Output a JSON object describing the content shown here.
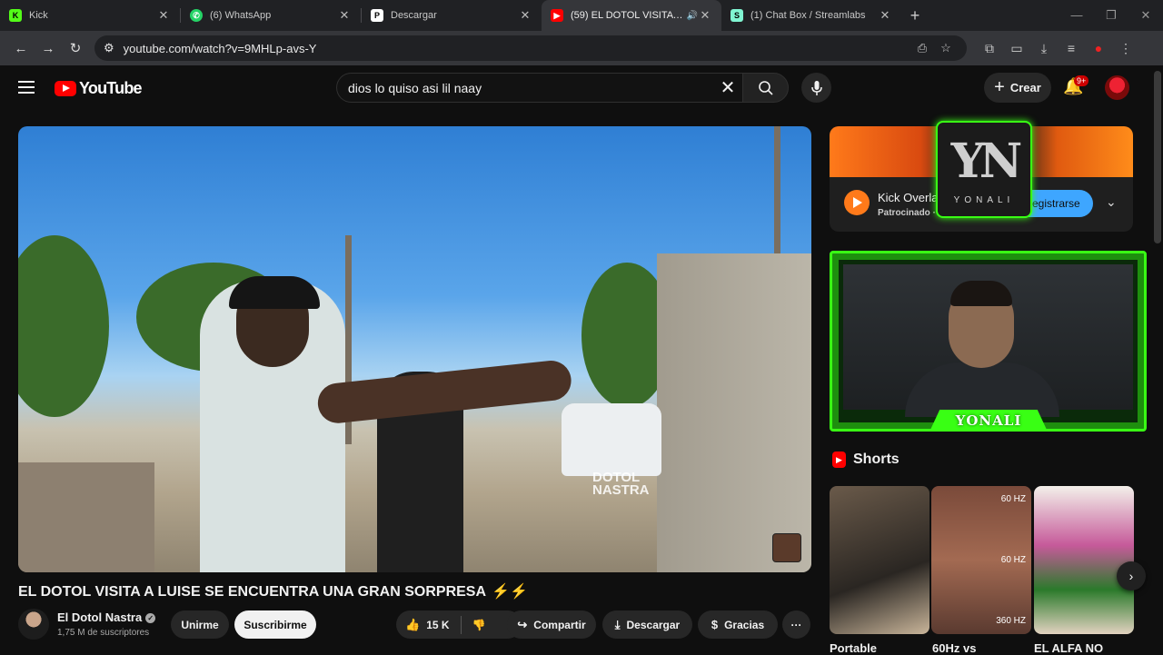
{
  "browser": {
    "tabs": [
      {
        "label": "Kick",
        "favicon": "kick-icon",
        "color": "#53fc18"
      },
      {
        "label": "(6) WhatsApp",
        "favicon": "whatsapp-icon",
        "color": "#25d366"
      },
      {
        "label": "Descargar",
        "favicon": "document-icon",
        "color": "#ffffff"
      },
      {
        "label": "(59) EL DOTOL VISITA A LUIS",
        "favicon": "youtube-icon",
        "color": "#ff0000",
        "active": true,
        "audio": true
      },
      {
        "label": "(1) Chat Box / Streamlabs",
        "favicon": "streamlabs-icon",
        "color": "#80f5d2"
      }
    ],
    "url": "youtube.com/watch?v=9MHLp-avs-Y"
  },
  "youtube": {
    "logo_text": "YouTube",
    "search_value": "dios lo quiso asi lil naay",
    "create_label": "Crear",
    "notif_count": "9+"
  },
  "video": {
    "watermark_line1": "DOTOL",
    "watermark_line2": "NASTRA",
    "title": "EL DOTOL VISITA A LUISE SE ENCUENTRA UNA GRAN SORPRESA",
    "title_emoji": "⚡⚡",
    "channel_name": "El Dotol Nastra",
    "subscribers": "1,75 M de suscriptores",
    "join_label": "Unirme",
    "subscribe_label": "Suscribirme",
    "likes": "15 K",
    "share_label": "Compartir",
    "download_label": "Descargar",
    "thanks_label": "Gracias"
  },
  "ad": {
    "title": "Kick Overla",
    "sponsored": "Patrocinado ·",
    "cta": "Registrarse"
  },
  "overlay": {
    "logo_letters": "YN",
    "logo_name": "YONALI",
    "webcam_label": "YONALI"
  },
  "shorts": {
    "heading": "Shorts",
    "hz_labels": [
      "60 HZ",
      "60 HZ",
      "360 HZ"
    ],
    "items": [
      {
        "title": "Portable"
      },
      {
        "title": "60Hz vs"
      },
      {
        "title": "EL ALFA NO"
      }
    ]
  }
}
